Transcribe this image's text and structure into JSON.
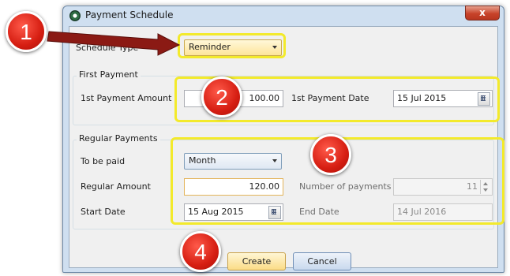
{
  "window": {
    "title": "Payment Schedule",
    "close_glyph": "x"
  },
  "schedule_type": {
    "label": "Schedule Type",
    "value": "Reminder"
  },
  "first_payment": {
    "legend": "First Payment",
    "amount_label": "1st Payment Amount",
    "amount_value": "100.00",
    "date_label": "1st Payment Date",
    "date_value": "15 Jul 2015"
  },
  "regular_payments": {
    "legend": "Regular Payments",
    "to_be_paid_label": "To be paid",
    "to_be_paid_value": "Month",
    "amount_label": "Regular Amount",
    "amount_value": "120.00",
    "num_payments_label": "Number of payments",
    "num_payments_value": "11",
    "start_label": "Start Date",
    "start_value": "15 Aug 2015",
    "end_label": "End Date",
    "end_value": "14 Jul 2016"
  },
  "buttons": {
    "create": "Create",
    "cancel": "Cancel"
  },
  "annotations": [
    "1",
    "2",
    "3",
    "4"
  ],
  "colors": {
    "highlight": "#f3ea2b",
    "badge": "#d61e12",
    "arrow": "#8b1a14"
  }
}
